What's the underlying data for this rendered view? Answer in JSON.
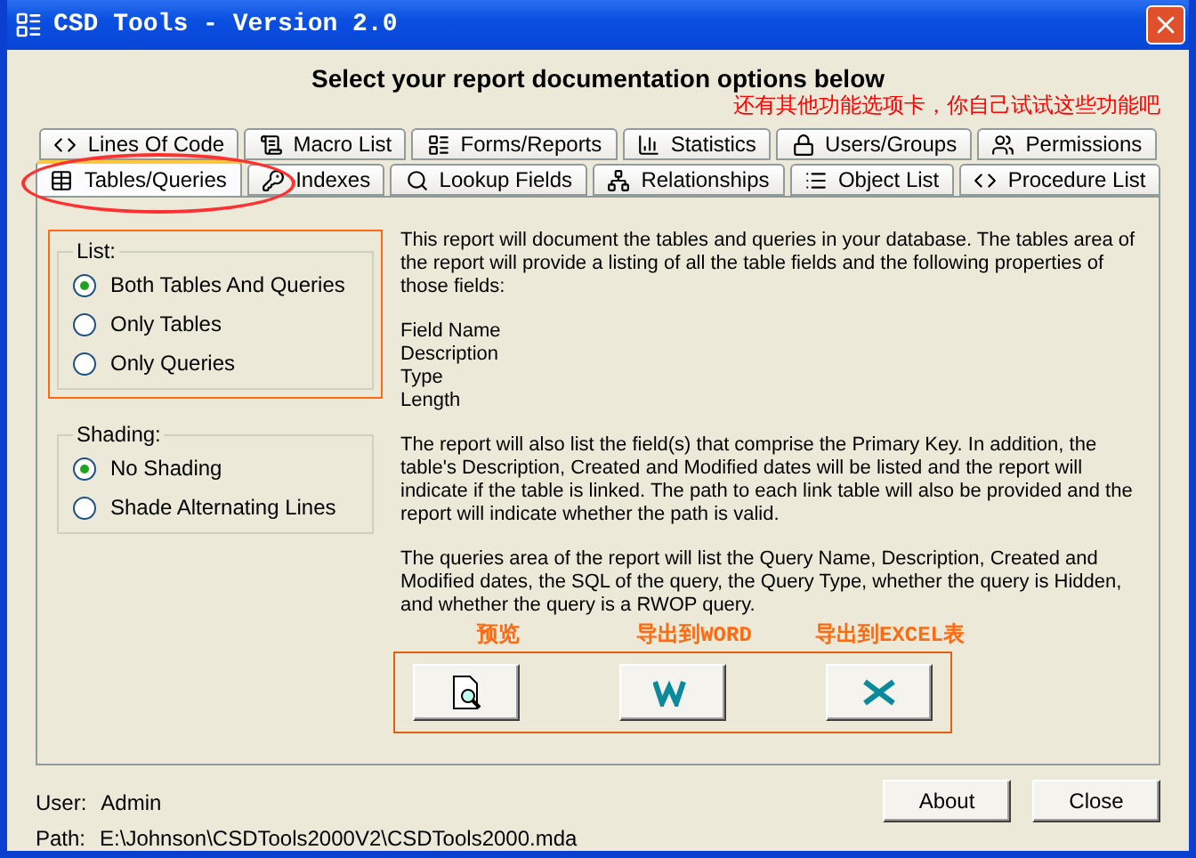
{
  "window": {
    "title": "CSD Tools - Version 2.0"
  },
  "heading": "Select your report documentation options below",
  "annotation_note": "还有其他功能选项卡，你自己试试这些功能吧",
  "tab_rows": [
    [
      {
        "label": "Lines Of Code",
        "kind": "code",
        "selected": false
      },
      {
        "label": "Macro List",
        "kind": "scroll",
        "selected": false
      },
      {
        "label": "Forms/Reports",
        "kind": "form",
        "selected": false
      },
      {
        "label": "Statistics",
        "kind": "chart",
        "selected": false
      },
      {
        "label": "Users/Groups",
        "kind": "lock",
        "selected": false
      },
      {
        "label": "Permissions",
        "kind": "perm",
        "selected": false
      }
    ],
    [
      {
        "label": "Tables/Queries",
        "kind": "table",
        "selected": true
      },
      {
        "label": "Indexes",
        "kind": "key",
        "selected": false
      },
      {
        "label": "Lookup Fields",
        "kind": "search",
        "selected": false
      },
      {
        "label": "Relationships",
        "kind": "network",
        "selected": false
      },
      {
        "label": "Object List",
        "kind": "list",
        "selected": false
      },
      {
        "label": "Procedure List",
        "kind": "code",
        "selected": false
      }
    ]
  ],
  "groups": [
    {
      "title": "List:",
      "highlighted": true,
      "options": [
        {
          "label": "Both Tables And Queries",
          "selected": true
        },
        {
          "label": "Only Tables",
          "selected": false
        },
        {
          "label": "Only Queries",
          "selected": false
        }
      ]
    },
    {
      "title": "Shading:",
      "highlighted": false,
      "options": [
        {
          "label": "No Shading",
          "selected": true
        },
        {
          "label": "Shade Alternating Lines",
          "selected": false
        }
      ]
    }
  ],
  "description": [
    {
      "kind": "paragraph",
      "text": "This report will document the tables and queries in your database. The tables area of the report will provide a listing of all the table fields and the following properties of those fields:"
    },
    {
      "kind": "lines",
      "lines": [
        "Field Name",
        "Description",
        "Type",
        "Length"
      ]
    },
    {
      "kind": "paragraph",
      "text": "The report will also list the field(s) that comprise the Primary Key. In addition, the table's Description, Created and Modified dates will be listed and the report will indicate if the table is linked. The path to each link table will also be provided and the report will indicate whether the path is valid."
    },
    {
      "kind": "paragraph",
      "text": "The queries area of the report will list the Query Name, Description, Created and Modified dates, the SQL of the query, the Query Type, whether the query is Hidden, and whether the query is a RWOP query."
    }
  ],
  "output_buttons": [
    {
      "annotation": "预览",
      "kind": "preview"
    },
    {
      "annotation": "导出到WORD",
      "kind": "word"
    },
    {
      "annotation": "导出到EXCEL表",
      "kind": "excel"
    }
  ],
  "status": [
    {
      "label": "User:",
      "value": "Admin"
    },
    {
      "label": "Path:",
      "value": "E:\\Johnson\\CSDTools2000V2\\CSDTools2000.mda"
    }
  ],
  "buttons": [
    "About",
    "Close"
  ]
}
